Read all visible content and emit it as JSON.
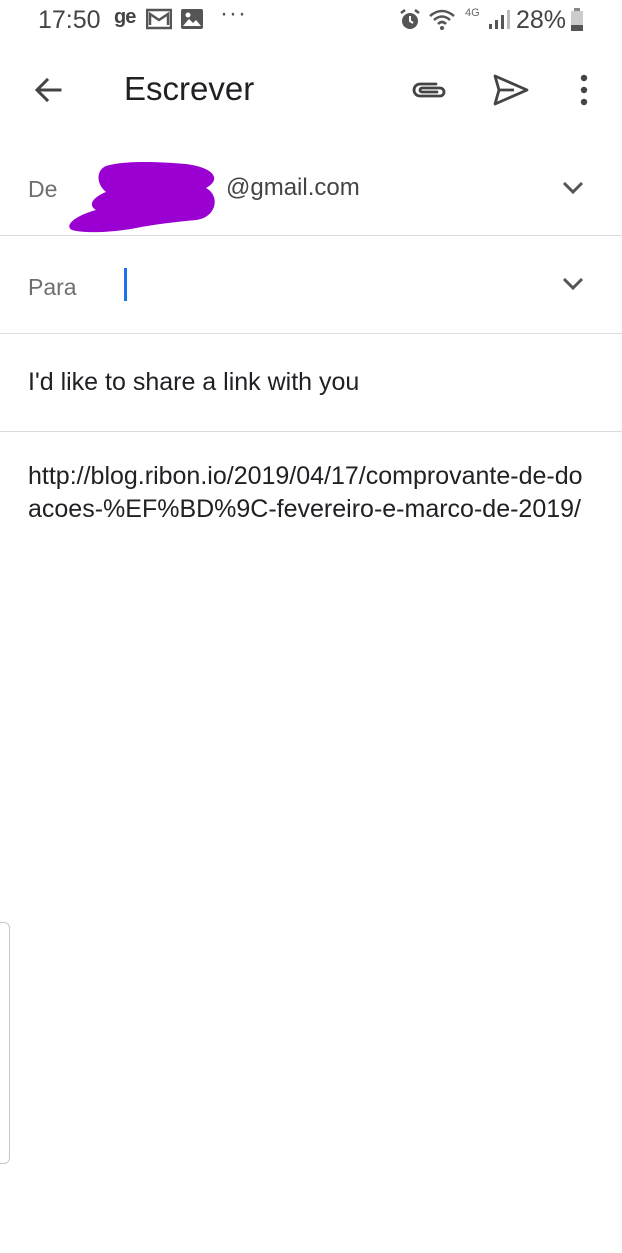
{
  "status_bar": {
    "time": "17:50",
    "carrier_badge": "ge",
    "overflow": "···",
    "network": "4G",
    "battery": "28%",
    "icons": [
      "gmail-notification-icon",
      "gallery-notification-icon",
      "alarm-icon",
      "wifi-icon",
      "signal-icon",
      "battery-icon"
    ]
  },
  "app_bar": {
    "title": "Escrever",
    "icons": [
      "back-arrow-icon",
      "paperclip-icon",
      "send-icon",
      "more-vert-icon"
    ]
  },
  "from": {
    "label": "De",
    "value": "@gmail.com"
  },
  "to": {
    "label": "Para",
    "value": ""
  },
  "subject": {
    "value": "I'd like to share a link with you"
  },
  "body": {
    "value": "http://blog.ribon.io/2019/04/17/comprovante-de-doacoes-%EF%BD%9C-fevereiro-e-marco-de-2019/"
  },
  "colors": {
    "redaction": "#9b00d3",
    "cursor": "#1a73e8",
    "divider": "#dadce0"
  }
}
